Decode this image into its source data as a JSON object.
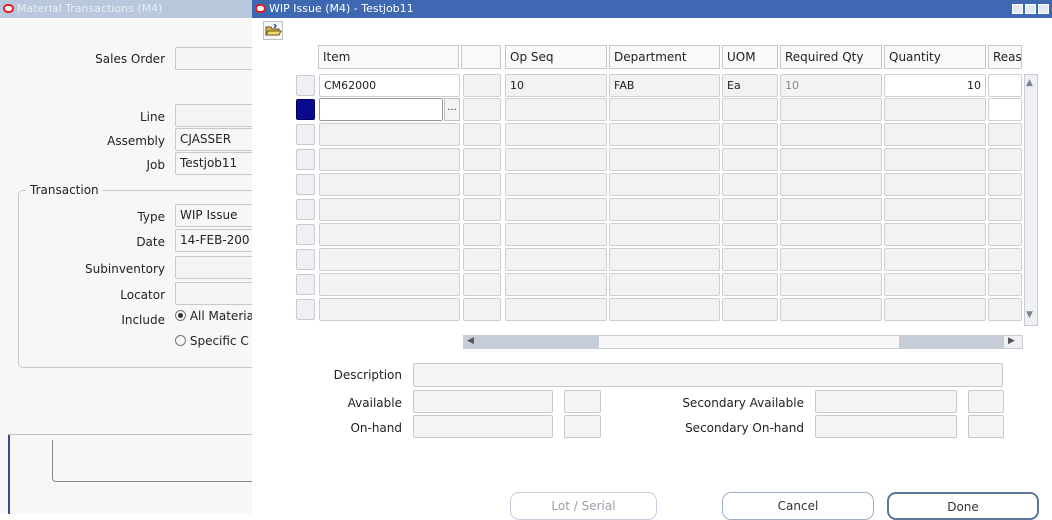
{
  "bg_window": {
    "title": "Material Transactions (M4)",
    "labels": {
      "sales_order": "Sales Order",
      "line": "Line",
      "assembly": "Assembly",
      "job": "Job",
      "type": "Type",
      "date": "Date",
      "subinventory": "Subinventory",
      "locator": "Locator",
      "include": "Include"
    },
    "values": {
      "assembly": "CJASSER",
      "job": "Testjob11",
      "type": "WIP Issue",
      "date": "14-FEB-200"
    },
    "transaction_group": "Transaction",
    "include_options": [
      "All Materia",
      "Specific C"
    ]
  },
  "main_window": {
    "title": "WIP Issue (M4) - Testjob11",
    "columns": [
      "Item",
      "",
      "Op Seq",
      "Department",
      "UOM",
      "Required Qty",
      "Quantity",
      "Reas"
    ],
    "row1": {
      "item": "CM62000",
      "op_seq": "10",
      "department": "FAB",
      "uom": "Ea",
      "required_qty": "10",
      "quantity": "10"
    },
    "lov_button": "...",
    "labels": {
      "description": "Description",
      "available": "Available",
      "on_hand": "On-hand",
      "secondary_available": "Secondary Available",
      "secondary_on_hand": "Secondary On-hand"
    },
    "buttons": {
      "lot_serial": "Lot / Serial",
      "cancel": "Cancel",
      "done": "Done"
    }
  },
  "colors": {
    "active_titlebar": "#3f68b2",
    "inactive_titlebar": "#b9c8dc",
    "oracle_red": "#e02020",
    "current_record": "#0a0a8c"
  }
}
